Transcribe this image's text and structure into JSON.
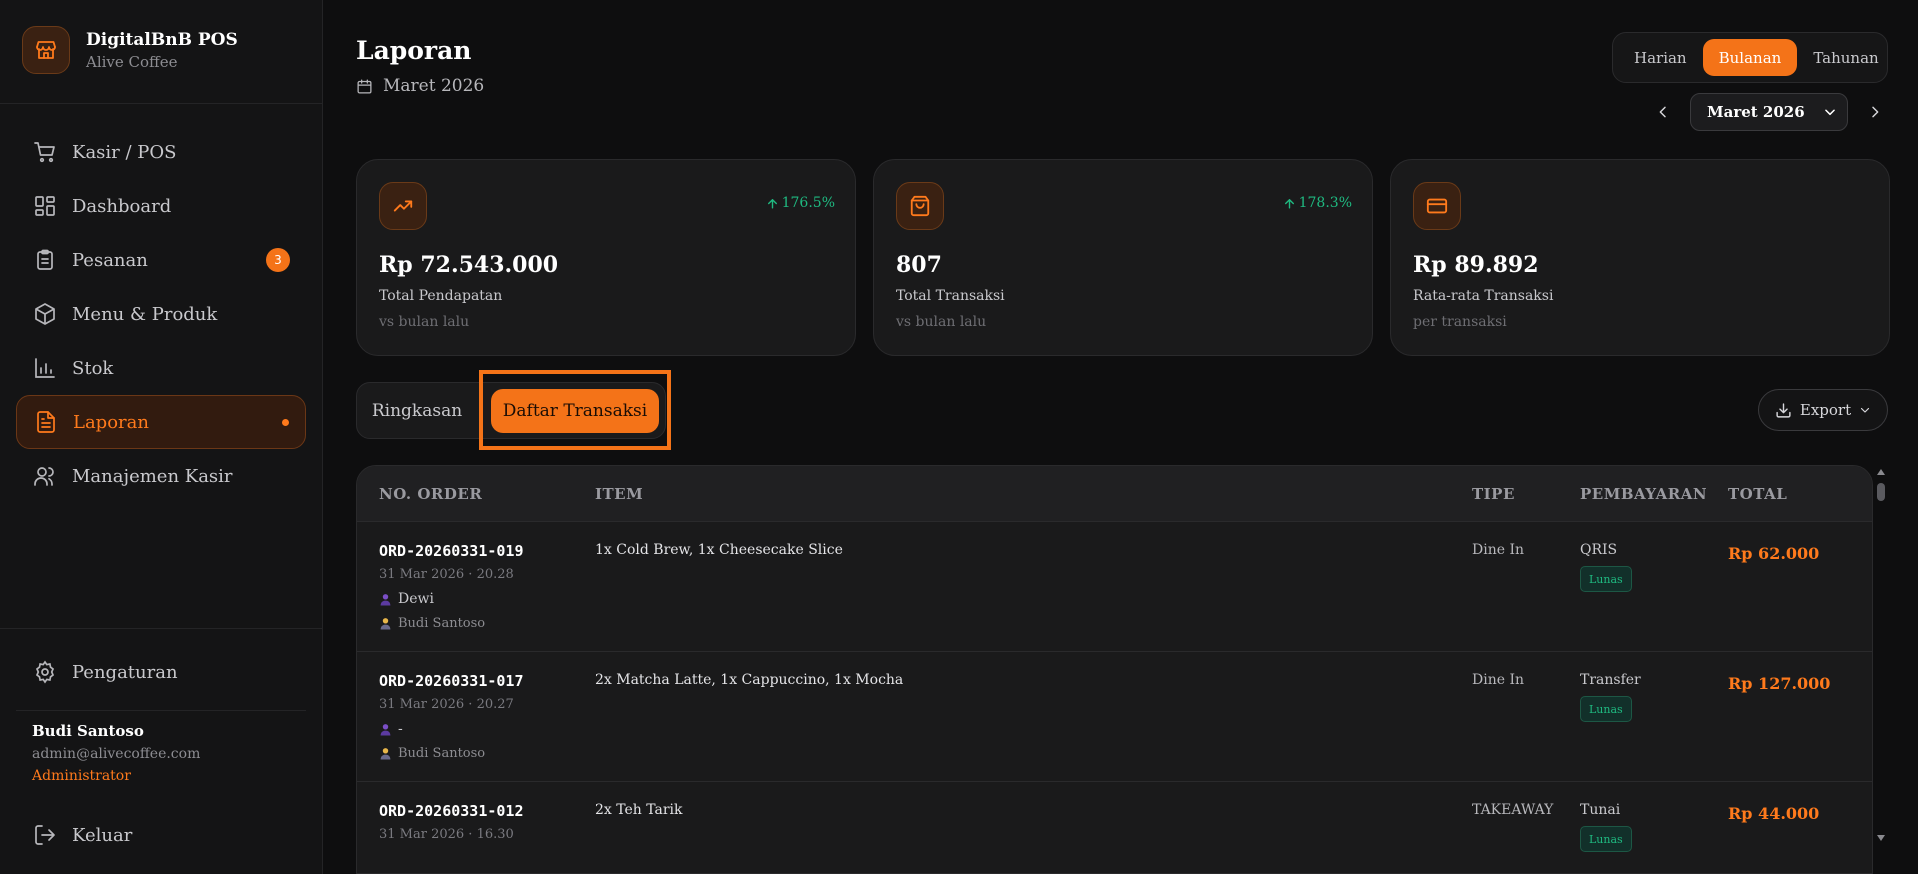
{
  "brand": {
    "name": "DigitalBnB POS",
    "subtitle": "Alive Coffee",
    "logo_icon": "store-icon"
  },
  "sidebar": {
    "items": [
      {
        "label": "Kasir / POS",
        "icon": "cart-icon"
      },
      {
        "label": "Dashboard",
        "icon": "dashboard-icon"
      },
      {
        "label": "Pesanan",
        "icon": "clipboard-icon",
        "badge": "3"
      },
      {
        "label": "Menu & Produk",
        "icon": "box-icon"
      },
      {
        "label": "Stok",
        "icon": "bar-chart-icon"
      },
      {
        "label": "Laporan",
        "icon": "file-icon",
        "active": true
      },
      {
        "label": "Manajemen Kasir",
        "icon": "users-icon"
      }
    ],
    "settings_label": "Pengaturan",
    "logout_label": "Keluar"
  },
  "user": {
    "name": "Budi Santoso",
    "email": "admin@alivecoffee.com",
    "role": "Administrator"
  },
  "header": {
    "title": "Laporan",
    "date": "Maret 2026"
  },
  "period": {
    "options": [
      "Harian",
      "Bulanan",
      "Tahunan"
    ],
    "selected": "Bulanan"
  },
  "month_select": {
    "value": "Maret 2026"
  },
  "stats": [
    {
      "icon": "trending-up-icon",
      "change": "176.5%",
      "value": "Rp 72.543.000",
      "label": "Total Pendapatan",
      "sub": "vs bulan lalu"
    },
    {
      "icon": "shopping-bag-icon",
      "change": "178.3%",
      "value": "807",
      "label": "Total Transaksi",
      "sub": "vs bulan lalu"
    },
    {
      "icon": "credit-card-icon",
      "change": "",
      "value": "Rp 89.892",
      "label": "Rata-rata Transaksi",
      "sub": "per transaksi"
    }
  ],
  "tabs": {
    "summary": "Ringkasan",
    "transactions": "Daftar Transaksi",
    "active": "Daftar Transaksi"
  },
  "export": {
    "label": "Export"
  },
  "table": {
    "headers": {
      "order": "NO. ORDER",
      "item": "ITEM",
      "type": "TIPE",
      "payment": "PEMBAYARAN",
      "total": "TOTAL"
    },
    "rows": [
      {
        "order": "ORD-20260331-019",
        "time": "31 Mar 2026 · 20.28",
        "customer": "Dewi",
        "cashier": "Budi Santoso",
        "items": "1x Cold Brew, 1x Cheesecake Slice",
        "type": "Dine In",
        "payment": "QRIS",
        "status": "Lunas",
        "total": "Rp 62.000"
      },
      {
        "order": "ORD-20260331-017",
        "time": "31 Mar 2026 · 20.27",
        "customer": "-",
        "cashier": "Budi Santoso",
        "items": "2x Matcha Latte, 1x Cappuccino, 1x Mocha",
        "type": "Dine In",
        "payment": "Transfer",
        "status": "Lunas",
        "total": "Rp 127.000"
      },
      {
        "order": "ORD-20260331-012",
        "time": "31 Mar 2026 · 16.30",
        "customer": "",
        "cashier": "",
        "items": "2x Teh Tarik",
        "type": "TAKEAWAY",
        "payment": "Tunai",
        "status": "Lunas",
        "total": "Rp 44.000"
      }
    ]
  },
  "colors": {
    "accent": "#f47318",
    "success": "#1fb980",
    "background": "#0e0e0f",
    "card": "#1a1a1b"
  }
}
